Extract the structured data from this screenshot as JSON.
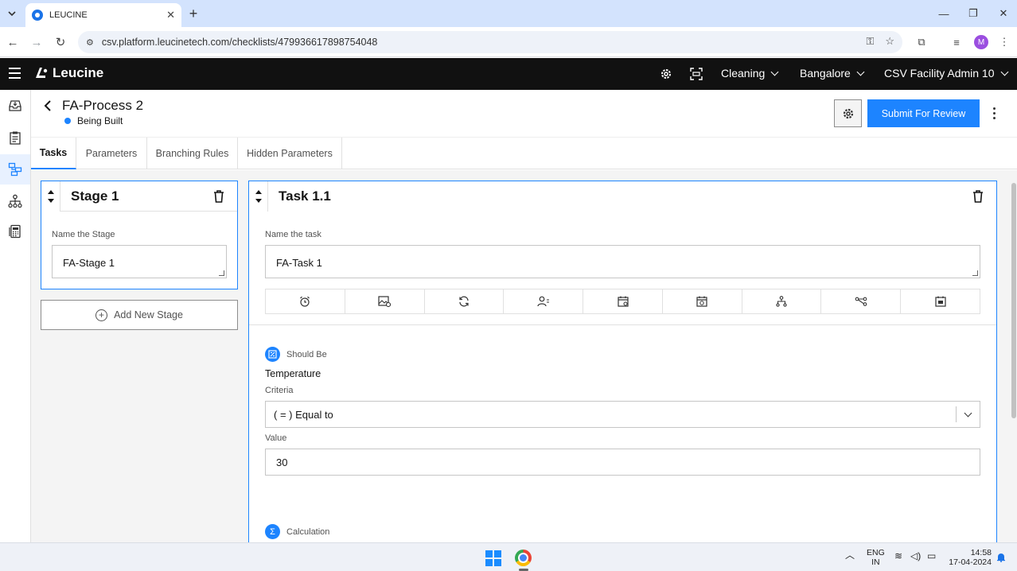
{
  "browser": {
    "tab_title": "LEUCINE",
    "url": "csv.platform.leucinetech.com/checklists/479936617898754048",
    "profile_initial": "M"
  },
  "app": {
    "logo_text": "Leucine",
    "header_selects": [
      "Cleaning",
      "Bangalore",
      "CSV Facility Admin 10"
    ]
  },
  "page": {
    "title": "FA-Process 2",
    "status": "Being Built",
    "status_color": "#1d84ff",
    "submit_label": "Submit For Review"
  },
  "tabs": [
    "Tasks",
    "Parameters",
    "Branching Rules",
    "Hidden Parameters"
  ],
  "stage": {
    "title": "Stage 1",
    "name_label": "Name the Stage",
    "name_value": "FA-Stage 1",
    "add_label": "Add New Stage"
  },
  "task": {
    "title": "Task 1.1",
    "name_label": "Name the task",
    "name_value": "FA-Task 1",
    "toolbar_icons": [
      "alarm-icon",
      "image-icon",
      "recurrence-icon",
      "assignee-icon",
      "schedule-icon",
      "due-date-icon",
      "hierarchy-icon",
      "flow-icon",
      "save-calendar-icon"
    ],
    "parameter": {
      "type": "Should Be",
      "name": "Temperature",
      "criteria_label": "Criteria",
      "criteria_value": "( = ) Equal to",
      "value_label": "Value",
      "value": "30"
    },
    "next_parameter_type": "Calculation"
  },
  "taskbar": {
    "lang_line1": "ENG",
    "lang_line2": "IN",
    "time": "14:58",
    "date": "17-04-2024"
  }
}
